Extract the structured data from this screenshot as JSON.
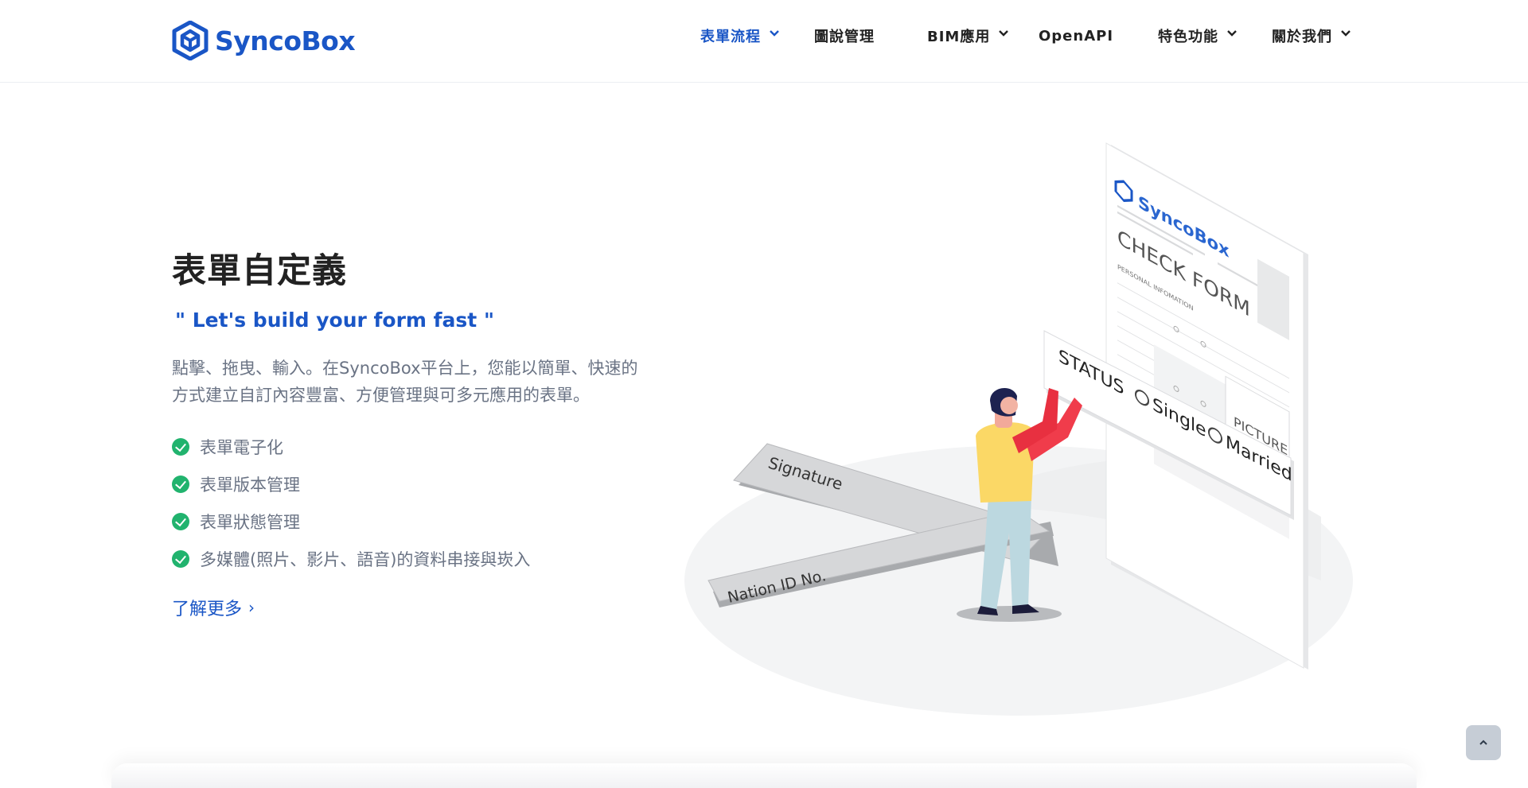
{
  "brand": {
    "name": "SyncoBox",
    "color": "#1a56c6",
    "icon": "cube-logo-icon"
  },
  "nav": {
    "items": [
      {
        "label": "表單流程",
        "has_dropdown": true,
        "active": true
      },
      {
        "label": "圖說管理",
        "has_dropdown": false,
        "active": false
      },
      {
        "label": "BIM應用",
        "has_dropdown": true,
        "active": false
      },
      {
        "label": "OpenAPI",
        "has_dropdown": false,
        "active": false
      },
      {
        "label": "特色功能",
        "has_dropdown": true,
        "active": false
      },
      {
        "label": "關於我們",
        "has_dropdown": true,
        "active": false
      }
    ]
  },
  "hero": {
    "title": "表單自定義",
    "tagline": "\" Let's build your form fast \"",
    "description_line1": "點擊、拖曳、輸入。在SyncoBox平台上，您能以簡單、快速的",
    "description_line2": "方式建立自訂內容豐富、方便管理與可多元應用的表單。",
    "features": [
      "表單電子化",
      "表單版本管理",
      "表單狀態管理",
      "多媒體(照片、影片、語音)的資料串接與崁入"
    ],
    "learn_more": "了解更多",
    "learn_more_icon": "chevron-right-icon"
  },
  "illustration": {
    "form_brand": "SyncoBox",
    "form_title": "CHECK FORM",
    "form_section": "PERSONAL INFOMATION",
    "picture_label": "PICTURE",
    "status_label": "STATUS",
    "option_single": "Single",
    "option_married": "Married",
    "signature_label": "Signature",
    "nation_id_label": "Nation ID No."
  },
  "back_to_top_icon": "chevron-up-icon",
  "colors": {
    "accent": "#1a56c6",
    "check": "#21b36e",
    "body_text": "#6a7384"
  }
}
